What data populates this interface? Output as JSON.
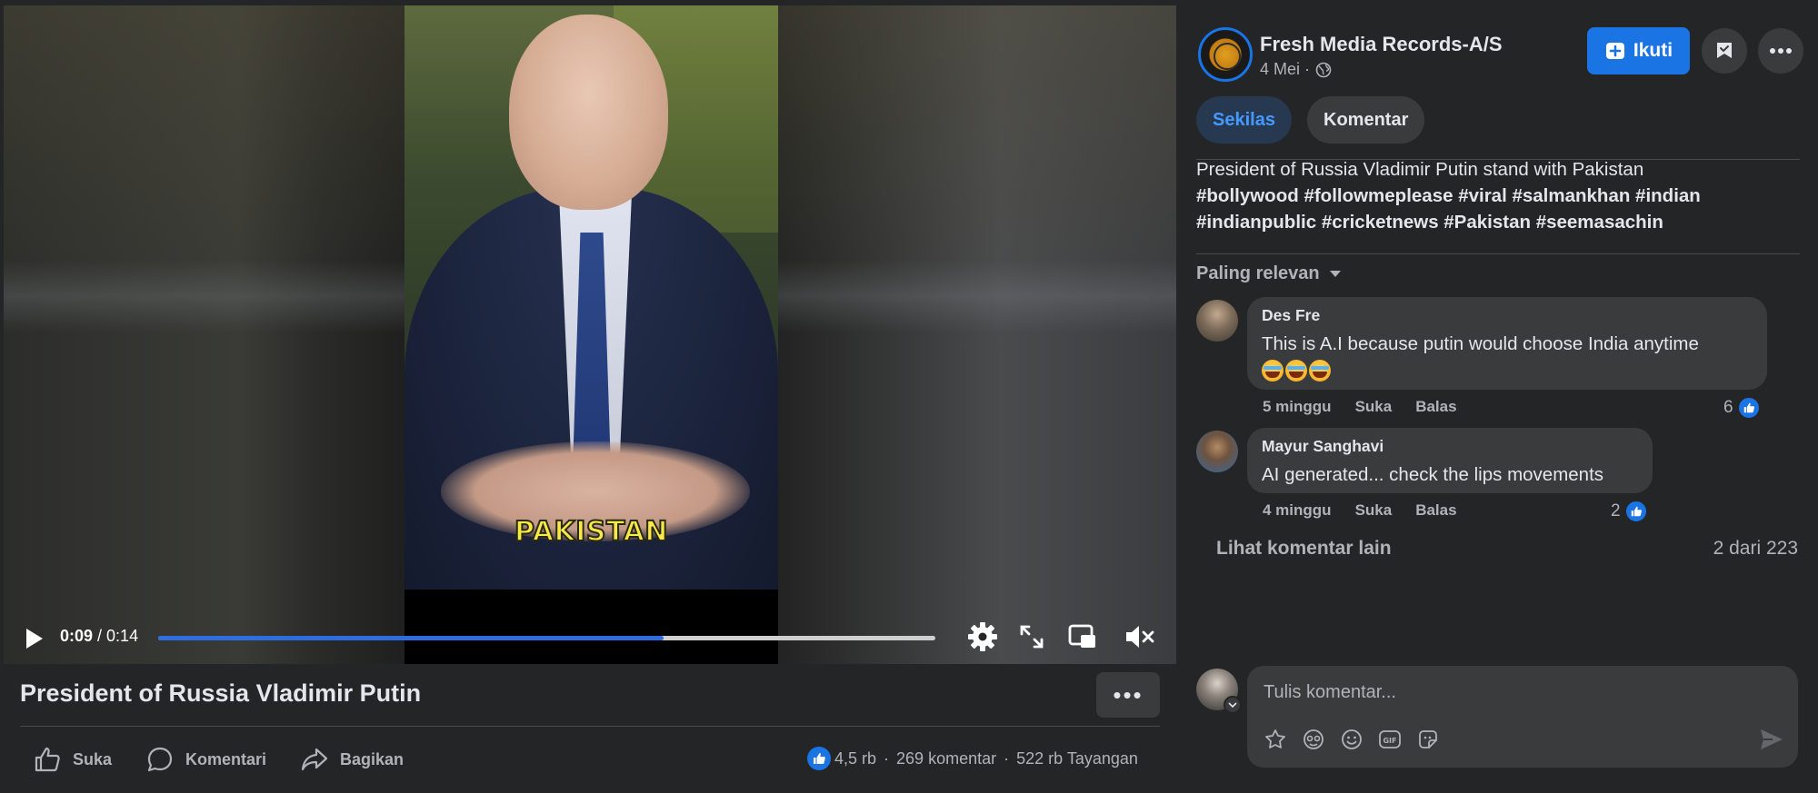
{
  "video": {
    "caption": "PAKISTAN",
    "current_time": "0:09",
    "separator": " / ",
    "duration": "0:14",
    "progress": 0.65
  },
  "post": {
    "title": "President of Russia Vladimir Putin",
    "actions": {
      "like": "Suka",
      "comment": "Komentari",
      "share": "Bagikan"
    },
    "stats": {
      "reactions": "4,5 rb",
      "comments": "269 komentar",
      "views": "522 rb Tayangan",
      "separator": "·"
    }
  },
  "sidebar": {
    "page_name": "Fresh Media Records-A/S",
    "date": "4 Mei ·",
    "follow_label": "Ikuti",
    "tabs": {
      "overview": "Sekilas",
      "comments": "Komentar"
    },
    "description": {
      "line1": "President of Russia Vladimir Putin stand with Pakistan",
      "line2": "#bollywood #followmeplease #viral #salmankhan #indian",
      "line3": "#indianpublic #cricketnews #Pakistan #seemasachin"
    },
    "sort_label": "Paling relevan",
    "comments": [
      {
        "author": "Des Fre",
        "text": "This is A.I because putin would choose India anytime",
        "time": "5 minggu",
        "like": "Suka",
        "reply": "Balas",
        "reactions": "6"
      },
      {
        "author": "Mayur Sanghavi",
        "text": "AI generated... check the lips movements",
        "time": "4 minggu",
        "like": "Suka",
        "reply": "Balas",
        "reactions": "2"
      }
    ],
    "more_comments": "Lihat komentar lain",
    "comment_count": "2 dari 223",
    "compose_placeholder": "Tulis komentar..."
  },
  "colors": {
    "accent": "#1b74e4",
    "background": "#242526",
    "bubble": "#3a3b3c"
  }
}
